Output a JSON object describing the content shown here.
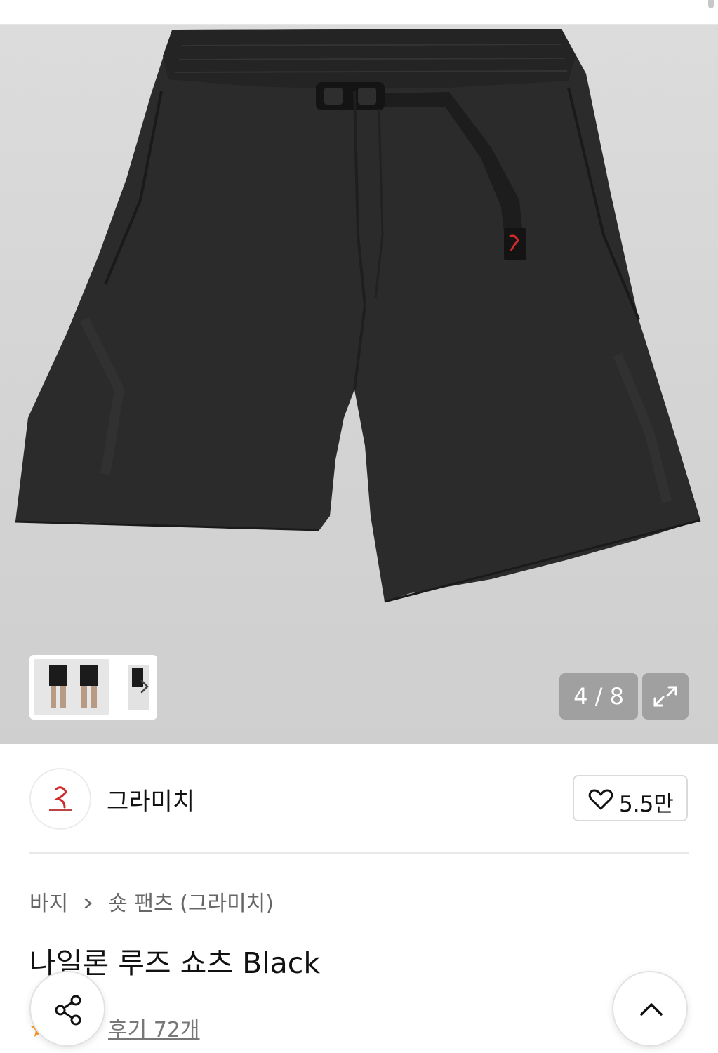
{
  "gallery": {
    "current": "4",
    "total": "8",
    "counter_separator": " / ",
    "image_icon": "product-black-shorts",
    "thumb_icon": "chevron-right-icon",
    "expand_icon": "expand-icon"
  },
  "brand": {
    "name": "그라미치",
    "logo_icon": "gramicci-logo",
    "like_count": "5.5만",
    "like_icon": "heart-outline-icon"
  },
  "breadcrumb": {
    "category": "바지",
    "subcategory": "숏 팬츠 (그라미치)"
  },
  "product": {
    "title": "나일론 루즈 쇼츠 Black"
  },
  "reviews": {
    "rating": "",
    "label": "후기 72개",
    "star_icon": "star-icon"
  },
  "fabs": {
    "share_icon": "share-icon",
    "scroll_top_icon": "chevron-up-icon"
  },
  "colors": {
    "accent_star": "#ff9a1f",
    "logo_red": "#d12a2a",
    "gallery_bg": "#d6d6d6"
  }
}
